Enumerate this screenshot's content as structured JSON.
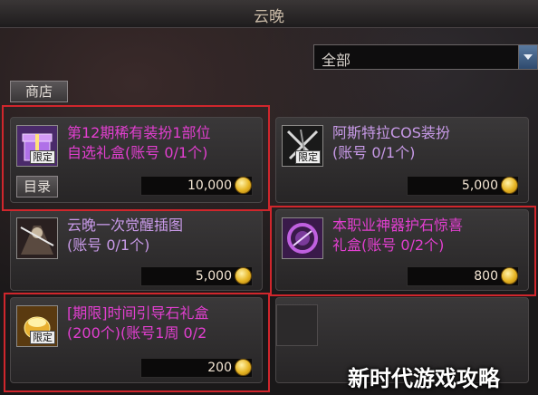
{
  "window": {
    "title": "云晚"
  },
  "filter": {
    "selected": "全部"
  },
  "tabs": {
    "shop": "商店"
  },
  "catalog_button": "目录",
  "colors": {
    "pink": "#e23fd0",
    "purple": "#c89ae8",
    "highlight": "#d0262c"
  },
  "items": [
    {
      "name1": "第12期稀有装扮1部位",
      "name2": "自选礼盒(账号 0/1个)",
      "price": "10,000",
      "limit": "限定",
      "icon": "gift-box-icon"
    },
    {
      "name1": "阿斯特拉COS装扮",
      "name2": "(账号 0/1个)",
      "price": "5,000",
      "limit": "限定",
      "icon": "swords-icon"
    },
    {
      "name1": "云晚一次觉醒插图",
      "name2": "(账号 0/1个)",
      "price": "5,000",
      "icon": "illustration-icon"
    },
    {
      "name1": "本职业神器护石惊喜",
      "name2": "礼盒(账号 0/2个)",
      "price": "800",
      "icon": "talisman-icon"
    },
    {
      "name1": "[期限]时间引导石礼盒",
      "name2": "(200个)(账号1周 0/2",
      "price": "200",
      "limit": "限定",
      "icon": "guide-stone-icon"
    }
  ],
  "watermark": "新时代游戏攻略"
}
